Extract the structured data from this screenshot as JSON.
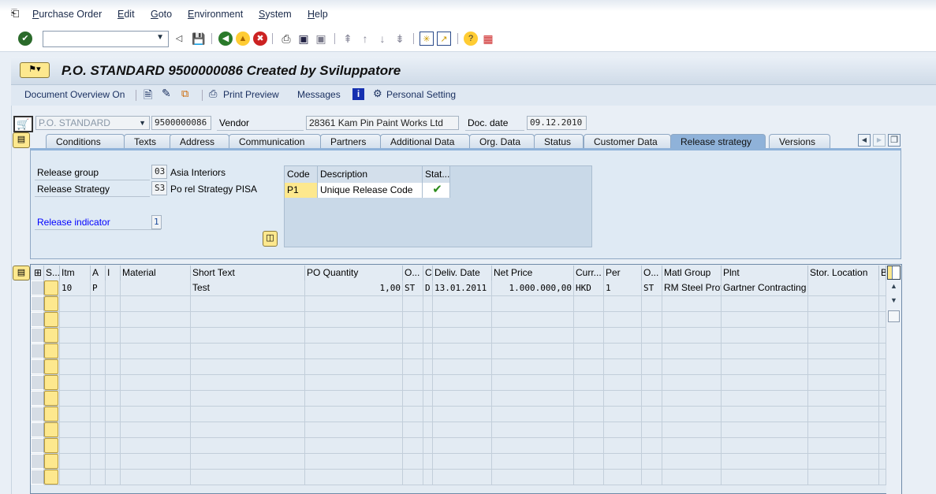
{
  "menu": [
    "Purchase Order",
    "Edit",
    "Goto",
    "Environment",
    "System",
    "Help"
  ],
  "toolbar": {
    "command_value": "",
    "icons": [
      "enter-icon",
      "back-nav-icon",
      "save-icon",
      "back-icon",
      "exit-icon",
      "cancel-icon",
      "print-icon",
      "find-icon",
      "find-next-icon",
      "first-page-icon",
      "previous-page-icon",
      "next-page-icon",
      "last-page-icon",
      "create-session-icon",
      "shortcut-icon",
      "help-icon",
      "layout-menu-icon"
    ]
  },
  "header": {
    "title": "P.O. STANDARD 9500000086 Created by Sviluppatore"
  },
  "appbar": {
    "doc_overview": "Document Overview On",
    "print_preview": "Print Preview",
    "messages": "Messages",
    "personal_setting": "Personal Setting"
  },
  "po": {
    "doc_type": "P.O. STANDARD",
    "po_number": "9500000086",
    "vendor_label": "Vendor",
    "vendor": "28361 Kam Pin Paint Works Ltd",
    "doc_date_label": "Doc. date",
    "doc_date": "09.12.2010"
  },
  "tabs": [
    {
      "label": "Conditions"
    },
    {
      "label": "Texts"
    },
    {
      "label": "Address"
    },
    {
      "label": "Communication"
    },
    {
      "label": "Partners"
    },
    {
      "label": "Additional Data"
    },
    {
      "label": "Org. Data"
    },
    {
      "label": "Status"
    },
    {
      "label": "Customer Data"
    },
    {
      "label": "Release strategy",
      "active": true
    },
    {
      "label": "Versions"
    }
  ],
  "release": {
    "group_label": "Release group",
    "group_code": "03",
    "group_text": "Asia Interiors",
    "strategy_label": "Release Strategy",
    "strategy_code": "S3",
    "strategy_text": "Po rel Strategy PISA",
    "indicator_label": "Release indicator",
    "indicator_value": "1",
    "table": {
      "headers": [
        "Code",
        "Description",
        "Stat..."
      ],
      "rows": [
        {
          "code": "P1",
          "description": "Unique Release Code",
          "status": "released"
        }
      ]
    }
  },
  "items": {
    "headers": [
      "S...",
      "Itm",
      "A",
      "I",
      "Material",
      "Short Text",
      "PO Quantity",
      "O...",
      "C",
      "Deliv. Date",
      "Net Price",
      "Curr...",
      "Per",
      "O...",
      "Matl Group",
      "Plnt",
      "Stor. Location",
      "B"
    ],
    "rows": [
      [
        "",
        "10",
        "P",
        "",
        "",
        "Test",
        "1,00",
        "ST",
        "D",
        "13.01.2011",
        "1.000.000,00",
        "HKD",
        "1",
        "ST",
        "RM Steel Prof",
        "Gartner Contracting",
        "",
        ""
      ]
    ]
  },
  "colors": {
    "accent": "#8fb2d9",
    "link": "#0000ff",
    "highlight": "#fde88e"
  }
}
